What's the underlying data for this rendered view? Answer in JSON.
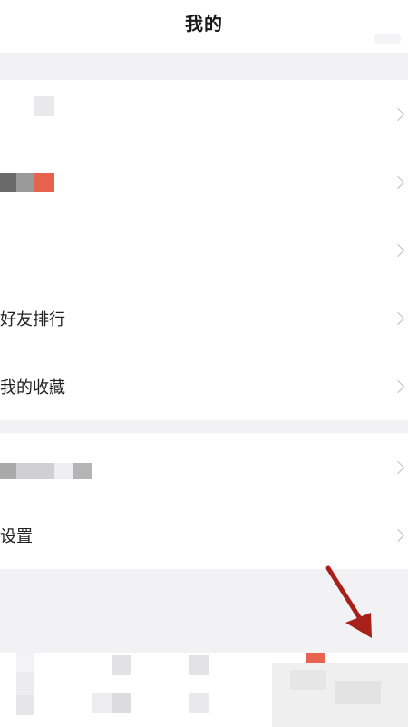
{
  "header": {
    "title": "我的"
  },
  "menu": {
    "group1": [
      {
        "id": "row-1",
        "label": ""
      },
      {
        "id": "row-2",
        "label": ""
      },
      {
        "id": "row-3",
        "label": ""
      },
      {
        "id": "friends-ranking",
        "label": "好友排行"
      },
      {
        "id": "my-favorites",
        "label": "我的收藏"
      }
    ],
    "group2": [
      {
        "id": "row-6",
        "label": ""
      },
      {
        "id": "settings",
        "label": "设置"
      }
    ]
  },
  "icons": {
    "chevron": "chevron-right-icon",
    "annotation": "red-arrow-annotation"
  },
  "colors": {
    "background": "#f2f2f4",
    "card": "#ffffff",
    "text": "#222222",
    "chevron": "#bdbdbd",
    "accent": "#e8634f",
    "annotation": "#a8201a"
  }
}
